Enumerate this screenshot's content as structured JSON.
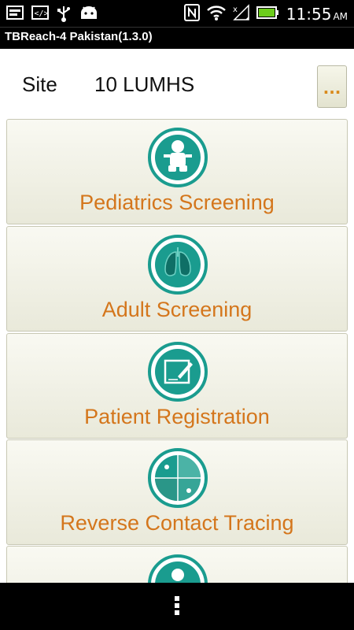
{
  "app_title": "TBReach-4 Pakistan(1.3.0)",
  "status": {
    "time": "11:55",
    "ampm": "AM"
  },
  "site": {
    "label": "Site",
    "value": "10 LUMHS",
    "more_label": "..."
  },
  "menu": [
    {
      "label": "Pediatrics Screening",
      "icon": "child-icon"
    },
    {
      "label": "Adult Screening",
      "icon": "lungs-icon"
    },
    {
      "label": "Patient Registration",
      "icon": "registration-form-icon"
    },
    {
      "label": "Reverse Contact Tracing",
      "icon": "contact-tracing-icon"
    },
    {
      "label": "",
      "icon": "person-icon"
    }
  ],
  "colors": {
    "accent": "#d4761c",
    "teal": "#1a9c8f"
  }
}
